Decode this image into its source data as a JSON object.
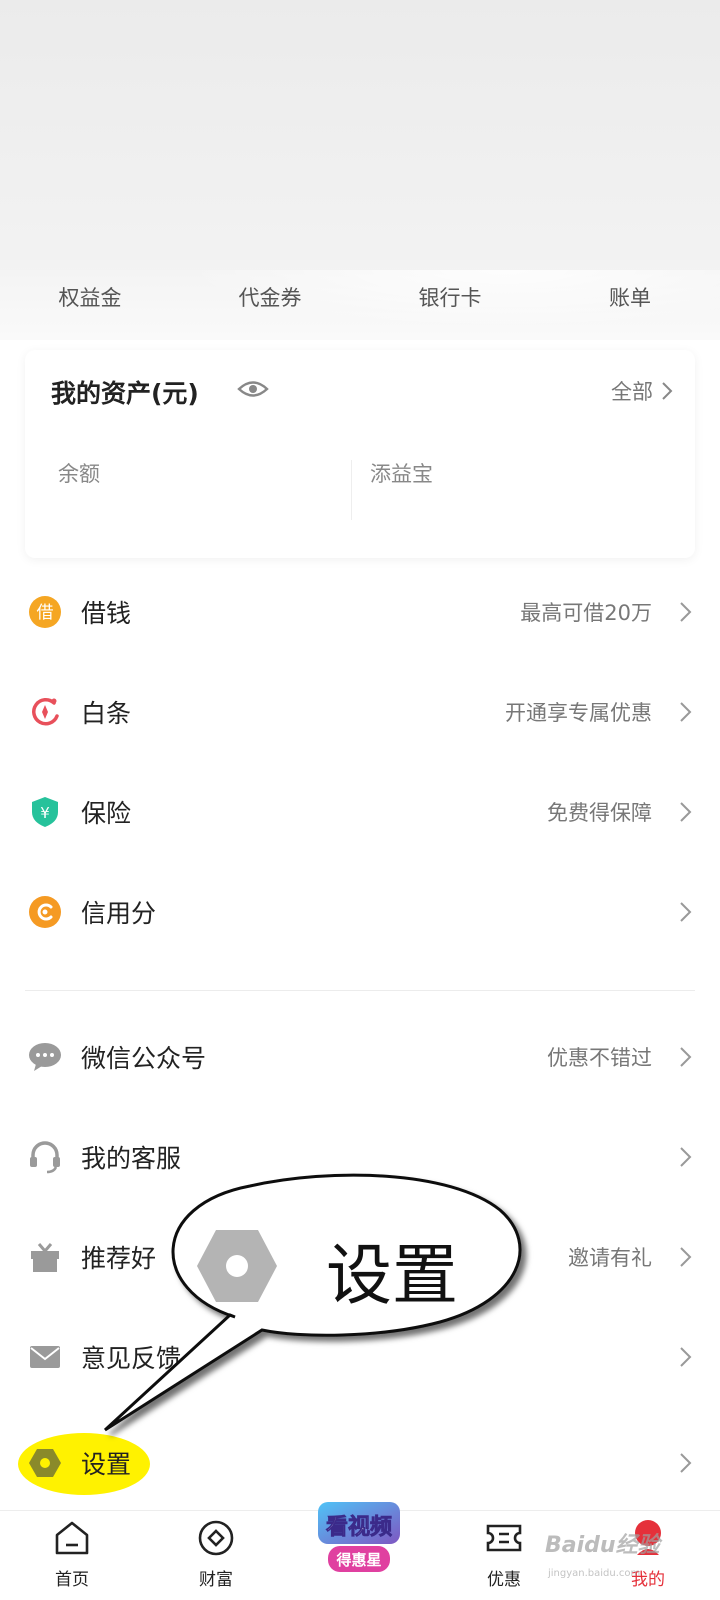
{
  "quick_links": [
    "权益金",
    "代金券",
    "银行卡",
    "账单"
  ],
  "assets": {
    "title": "我的资产(元)",
    "all_label": "全部",
    "balance_label": "余额",
    "tianyibao_label": "添益宝"
  },
  "menu": [
    {
      "label": "借钱",
      "hint": "最高可借20万",
      "icon": "borrow-icon",
      "color": "#f5a623"
    },
    {
      "label": "白条",
      "hint": "开通享专属优惠",
      "icon": "baitiao-icon",
      "color": "#e8505b"
    },
    {
      "label": "保险",
      "hint": "免费得保障",
      "icon": "insurance-shield-icon",
      "color": "#26c29b"
    },
    {
      "label": "信用分",
      "hint": "",
      "icon": "credit-score-icon",
      "color": "#f59a23"
    },
    {
      "label": "微信公众号",
      "hint": "优惠不错过",
      "icon": "chat-bubble-icon",
      "color": "#9a9a9a"
    },
    {
      "label": "我的客服",
      "hint": "",
      "icon": "headset-icon",
      "color": "#9a9a9a"
    },
    {
      "label": "推荐好",
      "hint": "邀请有礼",
      "icon": "gift-icon",
      "color": "#9a9a9a"
    },
    {
      "label": "意见反馈",
      "hint": "",
      "icon": "mail-icon",
      "color": "#9a9a9a"
    },
    {
      "label": "设置",
      "hint": "",
      "icon": "settings-hex-icon",
      "color": "#9a9a9a"
    }
  ],
  "callout": {
    "text": "设置"
  },
  "tabbar": [
    {
      "label": "首页",
      "icon": "home-icon"
    },
    {
      "label": "财富",
      "icon": "wealth-icon"
    },
    {
      "label": "",
      "icon": "video-promo-badge"
    },
    {
      "label": "优惠",
      "icon": "coupon-icon"
    },
    {
      "label": "我的",
      "icon": "profile-icon"
    }
  ],
  "promo": {
    "line1": "看视频",
    "line2": "得惠星"
  },
  "watermark": {
    "text": "Baidu经验",
    "sub": "jingyan.baidu.com"
  },
  "colors": {
    "active_tab": "#e5303a",
    "highlight": "#fff200"
  }
}
